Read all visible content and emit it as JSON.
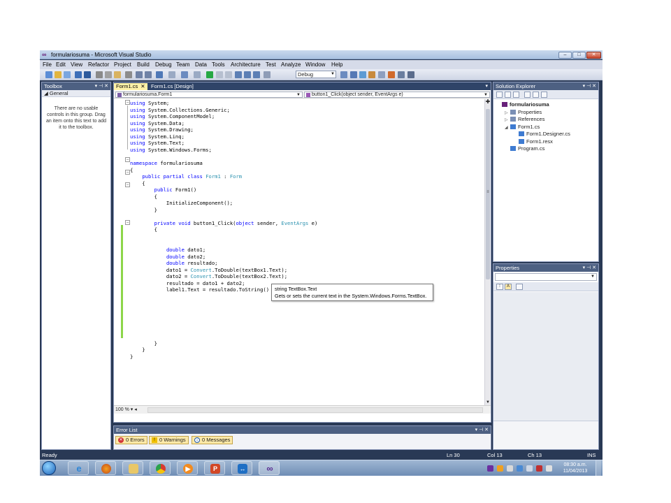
{
  "window": {
    "title": "formulariosuma - Microsoft Visual Studio"
  },
  "menu": [
    "File",
    "Edit",
    "View",
    "Refactor",
    "Project",
    "Build",
    "Debug",
    "Team",
    "Data",
    "Tools",
    "Architecture",
    "Test",
    "Analyze",
    "Window",
    "Help"
  ],
  "toolbar": {
    "configuration": "Debug"
  },
  "toolbox": {
    "title": "Toolbox",
    "group": "General",
    "empty_message": "There are no usable controls in this group. Drag an item onto this text to add it to the toolbox."
  },
  "tabs": [
    {
      "label": "Form1.cs",
      "active": true
    },
    {
      "label": "Form1.cs [Design]",
      "active": false
    }
  ],
  "navbar": {
    "class_selector": "formulariosuma.Form1",
    "member_selector": "button1_Click(object sender, EventArgs e)"
  },
  "code_lines": [
    "using System;",
    "using System.Collections.Generic;",
    "using System.ComponentModel;",
    "using System.Data;",
    "using System.Drawing;",
    "using System.Linq;",
    "using System.Text;",
    "using System.Windows.Forms;",
    "",
    "namespace formulariosuma",
    "{",
    "    public partial class Form1 : Form",
    "    {",
    "        public Form1()",
    "        {",
    "            InitializeComponent();",
    "        }",
    "",
    "        private void button1_Click(object sender, EventArgs e)",
    "        {",
    "",
    "",
    "            double dato1;",
    "            double dato2;",
    "            double resultado;",
    "            dato1 = Convert.ToDouble(textBox1.Text);",
    "            dato2 = Convert.ToDouble(textBox2.Text);",
    "            resultado = dato1 + dato2;",
    "            label1.Text = resultado.ToString()",
    "",
    "",
    "",
    "",
    "",
    "",
    "",
    "        }",
    "    }",
    "}"
  ],
  "tooltip": {
    "signature": "string TextBox.Text",
    "description": "Gets or sets the current text in the System.Windows.Forms.TextBox."
  },
  "editor": {
    "zoom": "100 %"
  },
  "error_list": {
    "title": "Error List",
    "errors": "0 Errors",
    "warnings": "0 Warnings",
    "messages": "0 Messages"
  },
  "solution_explorer": {
    "title": "Solution Explorer",
    "items": [
      {
        "label": "formulariosuma",
        "level": 0,
        "bold": true,
        "arrow": ""
      },
      {
        "label": "Properties",
        "level": 1,
        "bold": false,
        "arrow": "▷"
      },
      {
        "label": "References",
        "level": 1,
        "bold": false,
        "arrow": "▷"
      },
      {
        "label": "Form1.cs",
        "level": 1,
        "bold": false,
        "arrow": "◢"
      },
      {
        "label": "Form1.Designer.cs",
        "level": 2,
        "bold": false,
        "arrow": ""
      },
      {
        "label": "Form1.resx",
        "level": 2,
        "bold": false,
        "arrow": ""
      },
      {
        "label": "Program.cs",
        "level": 1,
        "bold": false,
        "arrow": ""
      }
    ]
  },
  "properties": {
    "title": "Properties"
  },
  "status": {
    "state": "Ready",
    "line": "Ln 30",
    "col": "Col 13",
    "ch": "Ch 13",
    "mode": "INS"
  },
  "taskbar": {
    "time": "08:30 a.m.",
    "date": "11/04/2013"
  },
  "colors": {
    "ide_background": "#293955",
    "keyword": "#0000ff",
    "type": "#2b91af",
    "changed_line": "#8dd64a",
    "active_tab": "#fff2a8"
  }
}
